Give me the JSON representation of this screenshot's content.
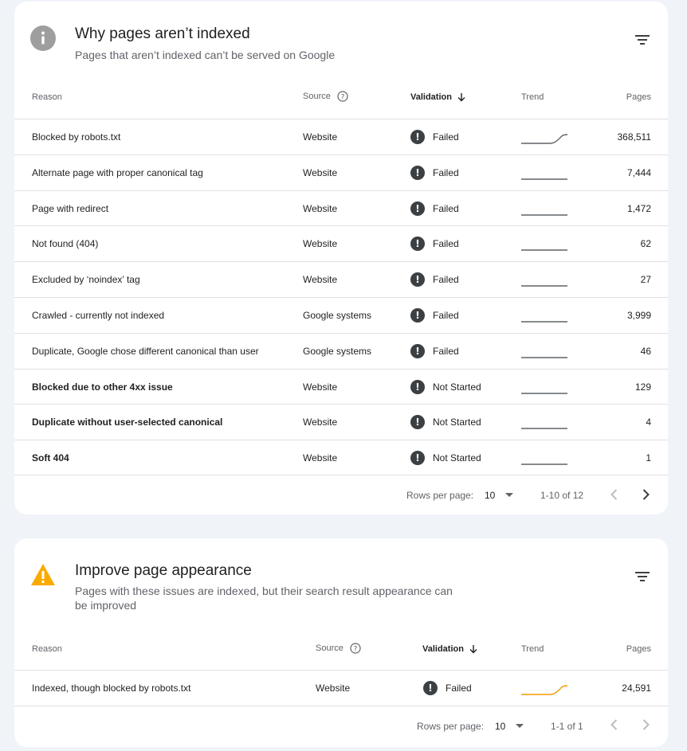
{
  "card1": {
    "title": "Why pages aren’t indexed",
    "subtitle": "Pages that aren’t indexed can’t be served on Google",
    "columns": {
      "reason": "Reason",
      "source": "Source",
      "validation": "Validation",
      "trend": "Trend",
      "pages": "Pages"
    },
    "rows": [
      {
        "reason": "Blocked by robots.txt",
        "source": "Website",
        "validation": "Failed",
        "pages": "368,511",
        "bold": false,
        "trend": "rising"
      },
      {
        "reason": "Alternate page with proper canonical tag",
        "source": "Website",
        "validation": "Failed",
        "pages": "7,444",
        "bold": false,
        "trend": "flat"
      },
      {
        "reason": "Page with redirect",
        "source": "Website",
        "validation": "Failed",
        "pages": "1,472",
        "bold": false,
        "trend": "flat"
      },
      {
        "reason": "Not found (404)",
        "source": "Website",
        "validation": "Failed",
        "pages": "62",
        "bold": false,
        "trend": "flat"
      },
      {
        "reason": "Excluded by ‘noindex’ tag",
        "source": "Website",
        "validation": "Failed",
        "pages": "27",
        "bold": false,
        "trend": "flat"
      },
      {
        "reason": "Crawled - currently not indexed",
        "source": "Google systems",
        "validation": "Failed",
        "pages": "3,999",
        "bold": false,
        "trend": "flat"
      },
      {
        "reason": "Duplicate, Google chose different canonical than user",
        "source": "Google systems",
        "validation": "Failed",
        "pages": "46",
        "bold": false,
        "trend": "flat"
      },
      {
        "reason": "Blocked due to other 4xx issue",
        "source": "Website",
        "validation": "Not Started",
        "pages": "129",
        "bold": true,
        "trend": "flat"
      },
      {
        "reason": "Duplicate without user-selected canonical",
        "source": "Website",
        "validation": "Not Started",
        "pages": "4",
        "bold": true,
        "trend": "flat"
      },
      {
        "reason": "Soft 404",
        "source": "Website",
        "validation": "Not Started",
        "pages": "1",
        "bold": true,
        "trend": "flat"
      }
    ],
    "pager": {
      "label": "Rows per page:",
      "value": "10",
      "range": "1-10 of 12"
    }
  },
  "card2": {
    "title": "Improve page appearance",
    "subtitle": "Pages with these issues are indexed, but their search result appearance can be improved",
    "columns": {
      "reason": "Reason",
      "source": "Source",
      "validation": "Validation",
      "trend": "Trend",
      "pages": "Pages"
    },
    "rows": [
      {
        "reason": "Indexed, though blocked by robots.txt",
        "source": "Website",
        "validation": "Failed",
        "pages": "24,591",
        "bold": false,
        "trend": "rising"
      }
    ],
    "pager": {
      "label": "Rows per page:",
      "value": "10",
      "range": "1-1 of 1"
    }
  },
  "colors": {
    "info_icon": "#9e9e9e",
    "warning_icon": "#f9ab00",
    "trend_gray": "#5f6368",
    "trend_orange": "#f29900",
    "status_dot": "#3c4043"
  },
  "icons": {
    "card1": "info-icon",
    "card2": "warning-icon",
    "filter": "filter-icon",
    "help": "help-icon",
    "sort": "arrow-down-icon",
    "prev": "chevron-left-icon",
    "next": "chevron-right-icon",
    "dropdown": "dropdown-icon",
    "status": "exclamation-icon"
  }
}
